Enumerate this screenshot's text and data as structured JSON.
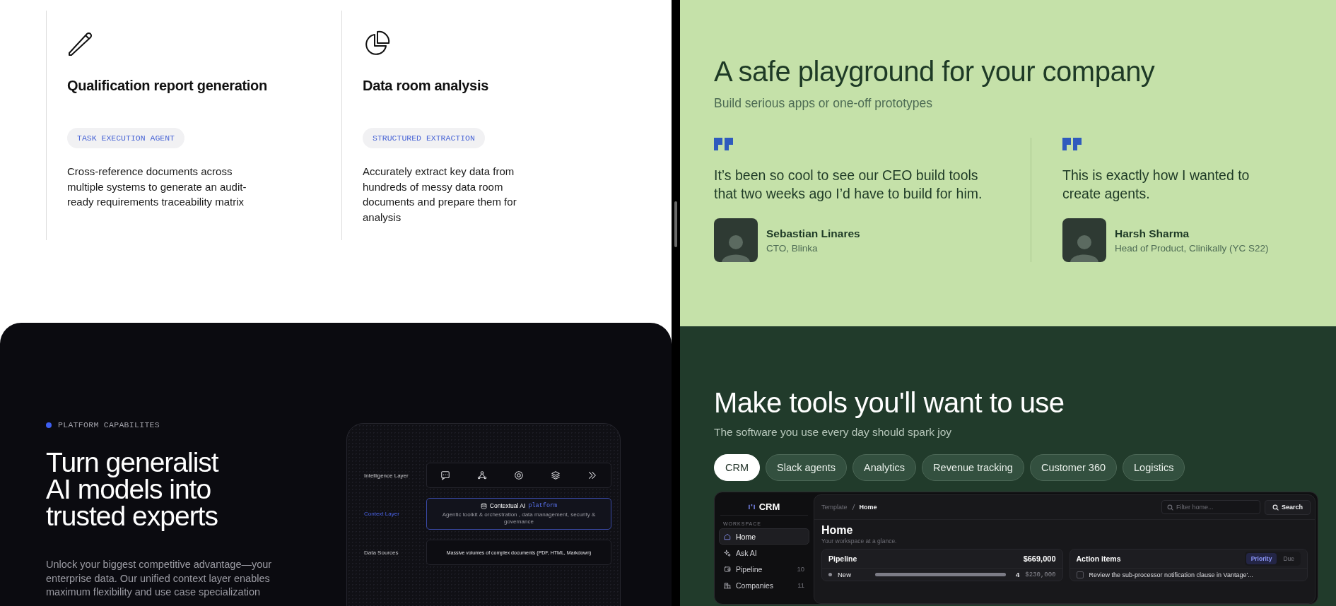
{
  "features": [
    {
      "title": "Qualification report generation",
      "tag": "TASK EXECUTION AGENT",
      "description": "Cross-reference documents across multiple systems to generate an audit-ready requirements traceability matrix"
    },
    {
      "title": "Data room analysis",
      "tag": "STRUCTURED EXTRACTION",
      "description": "Accurately extract key data from hundreds of messy data room documents and prepare them for analysis"
    }
  ],
  "platform": {
    "eyebrow": "PLATFORM CAPABILITES",
    "heading": "Turn generalist AI models into trusted experts",
    "body": "Unlock your biggest competitive advantage—your enterprise data. Our unified context layer enables maximum flexibility and use case specialization",
    "layers": [
      {
        "kind": "icons",
        "label": "Intelligence Layer",
        "selected": false
      },
      {
        "kind": "platform",
        "label": "Context Layer",
        "selected": true,
        "title": "Contextual AI",
        "badge": "platform",
        "subtitle": "Agentic toolkit & orchestration , data management, security & governance"
      },
      {
        "kind": "text",
        "label": "Data Sources",
        "selected": false,
        "text": "Massive volumes of complex documents (PDF, HTML, Markdown)"
      }
    ]
  },
  "playground": {
    "heading": "A safe playground for your company",
    "subheading": "Build serious apps or one-off prototypes",
    "testimonials": [
      {
        "quote": "It’s been so cool to see our CEO build tools that two weeks ago I’d have to build for him.",
        "name": "Sebastian Linares",
        "role": "CTO, Blinka"
      },
      {
        "quote": "This is exactly how I wanted to create agents.",
        "name": "Harsh Sharma",
        "role": "Head of Product, Clinikally (YC S22)"
      }
    ]
  },
  "tools": {
    "heading": "Make tools you'll want to use",
    "subheading": "The software you use every day should spark joy",
    "tabs": [
      {
        "label": "CRM",
        "selected": true
      },
      {
        "label": "Slack agents",
        "selected": false
      },
      {
        "label": "Analytics",
        "selected": false
      },
      {
        "label": "Revenue tracking",
        "selected": false
      },
      {
        "label": "Customer 360",
        "selected": false
      },
      {
        "label": "Logistics",
        "selected": false
      }
    ],
    "crm": {
      "app_name": "CRM",
      "section": "WORKSPACE",
      "sidebar": [
        {
          "label": "Home",
          "selected": true
        },
        {
          "label": "Ask AI",
          "selected": false
        },
        {
          "label": "Pipeline",
          "count": "10",
          "selected": false
        },
        {
          "label": "Companies",
          "count": "11",
          "selected": false
        }
      ],
      "breadcrumb": [
        "Template",
        "Home"
      ],
      "filter_placeholder": "Filter home...",
      "search_button": "Search",
      "page_title": "Home",
      "page_subtitle": "Your workspace at a glance.",
      "pipeline": {
        "title": "Pipeline",
        "total": "$669,000",
        "rows": [
          {
            "stage": "New",
            "level": 1,
            "count": "4",
            "amount": "$230,000"
          }
        ]
      },
      "actions": {
        "title": "Action items",
        "toggle": [
          {
            "label": "Priority",
            "selected": true
          },
          {
            "label": "Due",
            "selected": false
          }
        ],
        "items": [
          {
            "text": "Review the sub-processor notification clause in Vantage'...",
            "checked": false
          }
        ]
      }
    }
  }
}
